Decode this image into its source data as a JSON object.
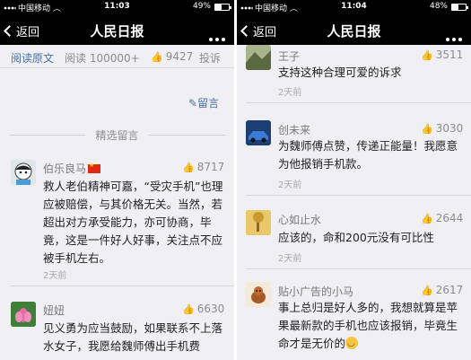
{
  "left": {
    "status": {
      "carrier": "中国移动",
      "time": "11:03",
      "battery": "49%"
    },
    "nav": {
      "back": "返回",
      "title": "人民日报"
    },
    "stats": {
      "read_original": "阅读原文",
      "reads": "阅读 100000+",
      "likes": "9427",
      "report": "投诉"
    },
    "write_comment": "留言",
    "featured_title": "精选留言",
    "comments": [
      {
        "user": "伯乐良马",
        "likes": "8717",
        "text": "救人老伯精神可嘉，“受灾手机”也理应被赔偿，与其价格无关。当然，若超出对方承受能力，亦可协商，毕竟，这是一件好人好事，关注点不应被手机左右。",
        "time": "2天前"
      },
      {
        "user": "妞妞",
        "likes": "6630",
        "text": "见义勇为应当鼓励，如果联系不上落水女子，我愿给魏师傅出手机费"
      }
    ]
  },
  "right": {
    "status": {
      "carrier": "中国移动",
      "time": "11:04",
      "battery": "48%"
    },
    "nav": {
      "back": "返回",
      "title": "人民日报"
    },
    "comments": [
      {
        "user": "王子",
        "likes": "3511",
        "text": "支持这种合理可爱的诉求",
        "time": "2天前"
      },
      {
        "user": "创未来",
        "likes": "3030",
        "text": "为魏师傅点赞，传递正能量！我愿意为他报销手机款。",
        "time": "2天前"
      },
      {
        "user": "心如止水",
        "likes": "2644",
        "text": "应该的，命和200元没有可比性",
        "time": "2天前"
      },
      {
        "user": "贴小广告的小马",
        "likes": "2617",
        "text": "事上总归是好人多的，我想就算是苹果最新款的手机也应该报销，毕竟生命才是无价的"
      }
    ]
  },
  "colors": {
    "accent": "#4a6fa5",
    "navbar": "#000000",
    "background": "#efeff4"
  }
}
